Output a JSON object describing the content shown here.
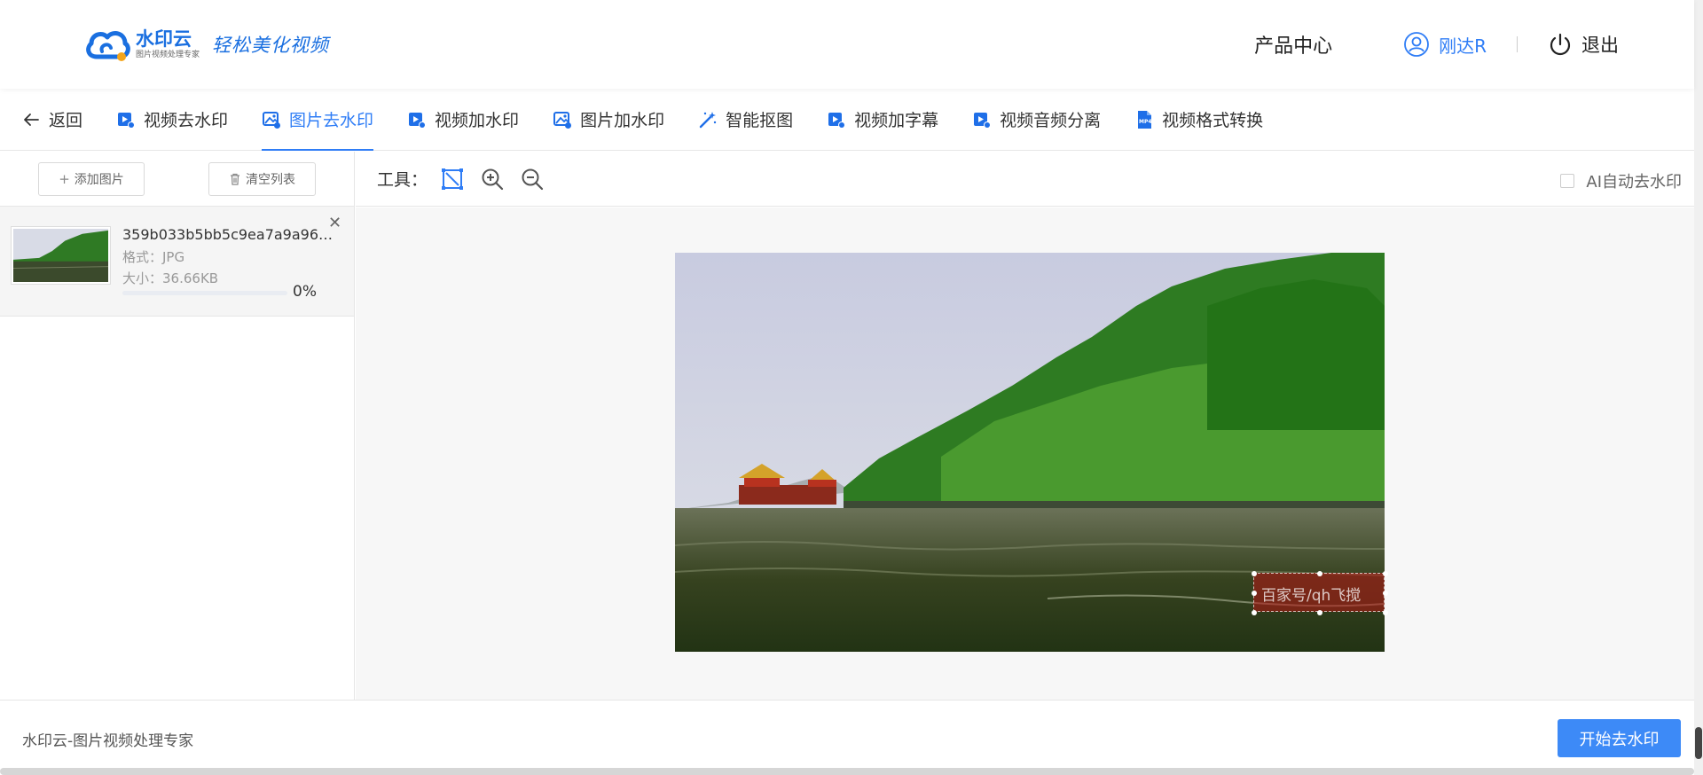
{
  "header": {
    "logo_brand": "水印云",
    "logo_sub": "图片视频处理专家",
    "slogan": "轻松美化视频",
    "product_center": "产品中心",
    "user_name": "刚达R",
    "logout": "退出"
  },
  "tabs": {
    "back": "返回",
    "items": [
      {
        "label": "视频去水印",
        "icon": "video-icon"
      },
      {
        "label": "图片去水印",
        "icon": "image-icon",
        "active": true
      },
      {
        "label": "视频加水印",
        "icon": "video-icon"
      },
      {
        "label": "图片加水印",
        "icon": "image-icon"
      },
      {
        "label": "智能抠图",
        "icon": "magic-wand-icon"
      },
      {
        "label": "视频加字幕",
        "icon": "video-icon"
      },
      {
        "label": "视频音频分离",
        "icon": "video-icon"
      },
      {
        "label": "视频格式转换",
        "icon": "mp4-file-icon"
      }
    ]
  },
  "left_panel": {
    "add_image": "添加图片",
    "clear_list": "清空列表",
    "file": {
      "name": "359b033b5bb5c9ea7a9a9622...",
      "format": "格式：JPG",
      "size": "大小：36.66KB",
      "progress_text": "0%",
      "progress": 0
    }
  },
  "workspace": {
    "tools_label": "工具：",
    "ai_auto": "AI自动去水印",
    "watermark_text": "百家号/qh飞搅"
  },
  "footer": {
    "text": "水印云-图片视频处理专家",
    "start_button": "开始去水印"
  },
  "colors": {
    "accent": "#2f7df6",
    "button": "#3d8af7"
  }
}
